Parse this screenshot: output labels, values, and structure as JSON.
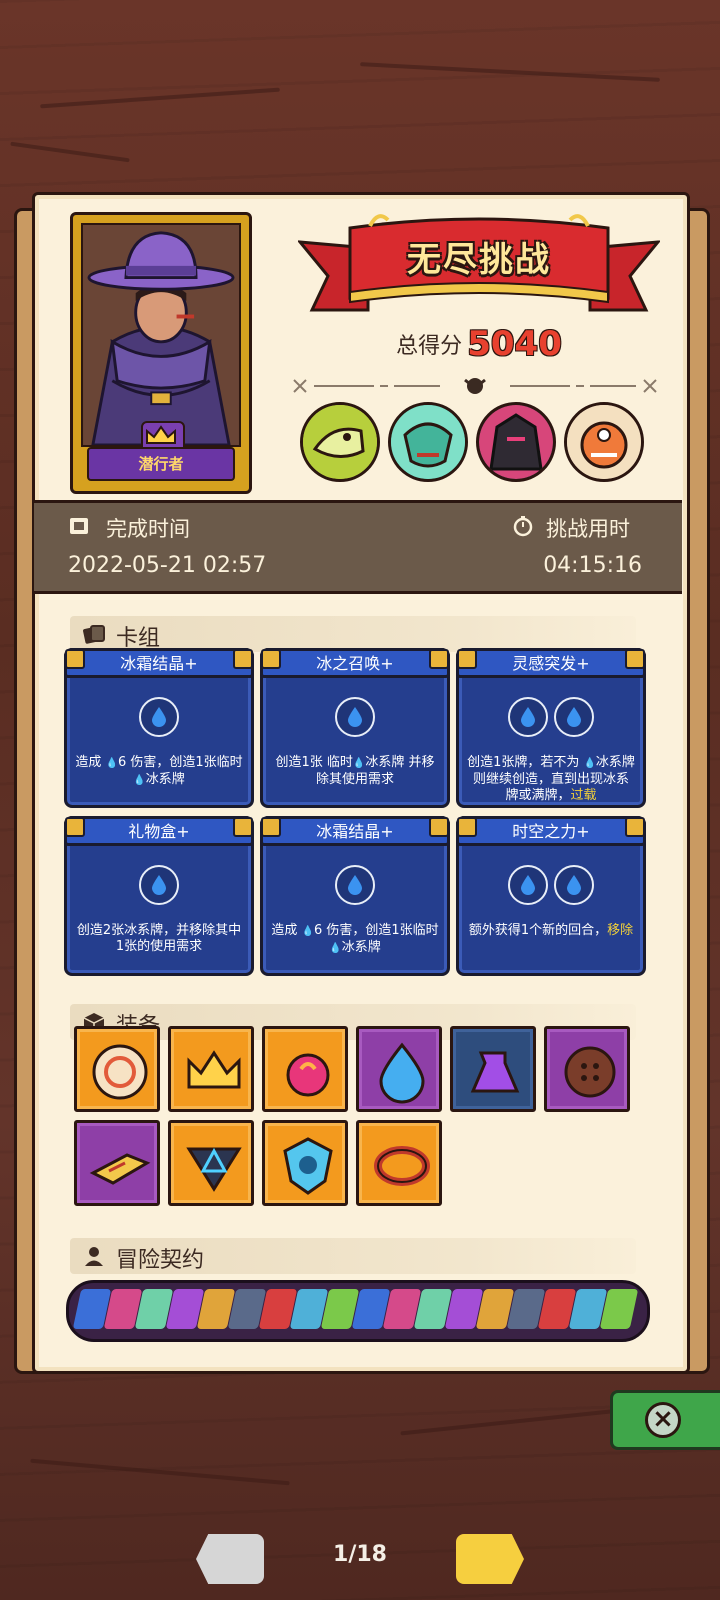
{
  "hero": {
    "name": "潜行者"
  },
  "mode": {
    "title": "无尽挑战"
  },
  "score": {
    "label": "总得分",
    "value": "5040"
  },
  "bosses": [
    "boss-bone-dragon",
    "boss-troll-shaman",
    "boss-dark-knight",
    "boss-fire-mask"
  ],
  "times": {
    "complete_label": "完成时间",
    "complete_value": "2022-05-21 02:57",
    "duration_label": "挑战用时",
    "duration_value": "04:15:16"
  },
  "sections": {
    "deck": "卡组",
    "equipment": "装备",
    "contract": "冒险契约"
  },
  "deck": [
    {
      "title": "冰霜结晶+",
      "gems": 1,
      "pre": "造成 ",
      "mid": "6 伤害，创造1张临时",
      "post": "冰系牌",
      "hl": ""
    },
    {
      "title": "冰之召唤+",
      "gems": 1,
      "pre": "创造1张 临时",
      "mid": "冰系牌 并移除其使用需求",
      "post": "",
      "hl": ""
    },
    {
      "title": "灵感突发+",
      "gems": 2,
      "pre": "创造1张牌，若不为 ",
      "mid": "冰系牌则继续创造，直到出现冰系牌或满牌，",
      "post": "",
      "hl": "过载"
    },
    {
      "title": "礼物盒+",
      "gems": 1,
      "pre": "创造2张冰系牌，并移除其中1张的使用需求",
      "mid": "",
      "post": "",
      "hl": ""
    },
    {
      "title": "冰霜结晶+",
      "gems": 1,
      "pre": "造成 ",
      "mid": "6 伤害，创造1张临时",
      "post": "冰系牌",
      "hl": ""
    },
    {
      "title": "时空之力+",
      "gems": 2,
      "pre": "额外获得1个新的回合，",
      "mid": "",
      "post": "",
      "hl": "移除"
    }
  ],
  "equipment": [
    {
      "icon": "sun-medallion-icon",
      "color": "#f39a1e"
    },
    {
      "icon": "golden-crown-icon",
      "color": "#f39a1e"
    },
    {
      "icon": "fire-orb-icon",
      "color": "#f39a1e"
    },
    {
      "icon": "water-drop-icon",
      "color": "#8e3fa7"
    },
    {
      "icon": "potion-jug-icon",
      "color": "#2e4d7d"
    },
    {
      "icon": "wooden-button-icon",
      "color": "#8e3fa7"
    },
    {
      "icon": "spell-book-icon",
      "color": "#8e3fa7"
    },
    {
      "icon": "hexagram-amulet-icon",
      "color": "#f39a1e"
    },
    {
      "icon": "ice-shield-gem-icon",
      "color": "#f39a1e"
    },
    {
      "icon": "spiked-bracelet-icon",
      "color": "#f39a1e"
    }
  ],
  "pager": {
    "label": "1/18"
  },
  "colors": {
    "accent_score": "#e8412f",
    "card_blue": "#253e8e",
    "parchment": "#fbf1db"
  }
}
